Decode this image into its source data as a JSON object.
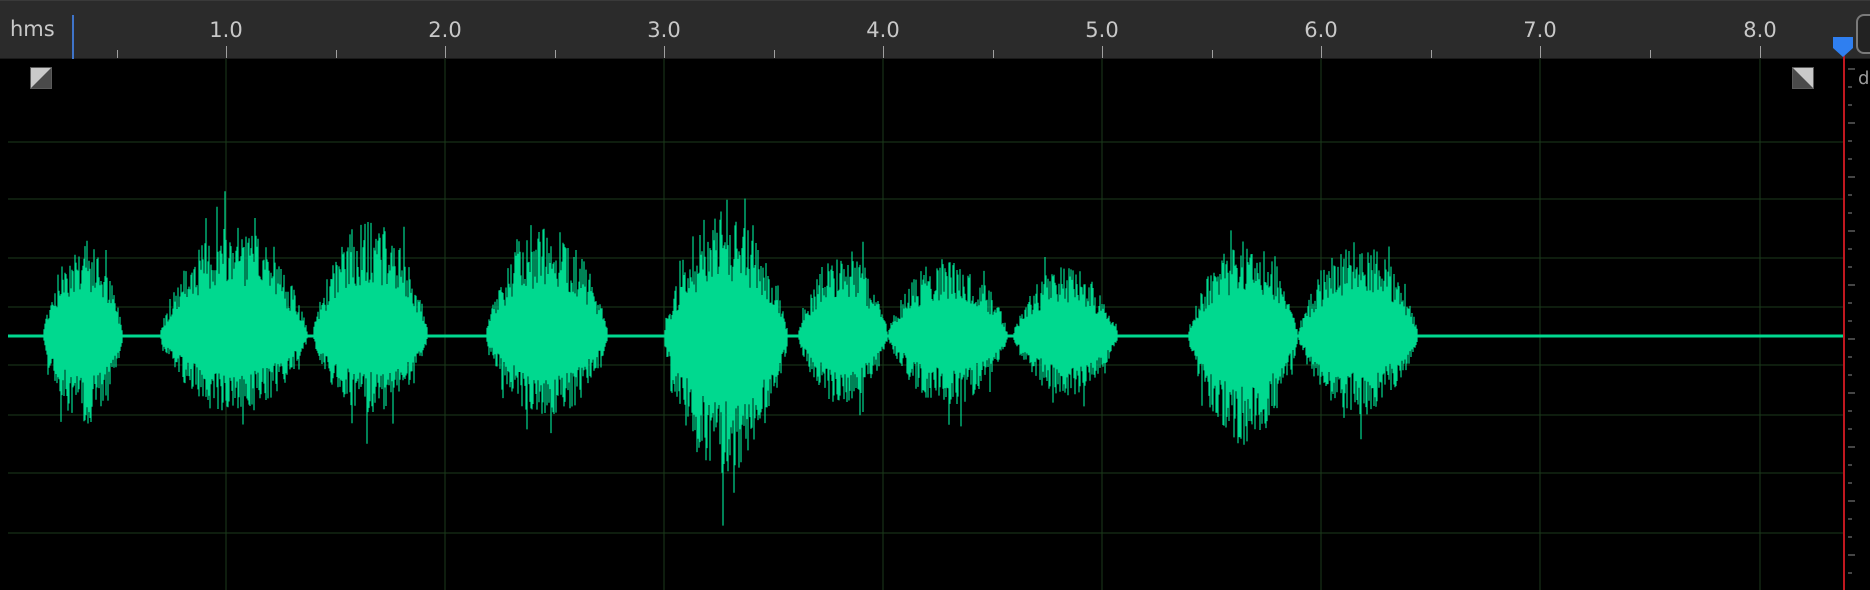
{
  "ruler": {
    "unit_label": "hms",
    "tick_labels": [
      "1.0",
      "2.0",
      "3.0",
      "4.0",
      "5.0",
      "6.0",
      "7.0",
      "8.0"
    ]
  },
  "db_scale": {
    "unit_label": "d"
  },
  "waveform": {
    "color": "#00d98f",
    "grid_color": "#1b3a1b",
    "background": "#000000"
  },
  "playhead": {
    "line_color": "#c0181f",
    "marker_color": "#2f7ff0"
  },
  "icons": {
    "fade_in": "fade-in-icon",
    "fade_out": "fade-out-icon",
    "playhead_marker": "playhead-marker-icon"
  }
}
